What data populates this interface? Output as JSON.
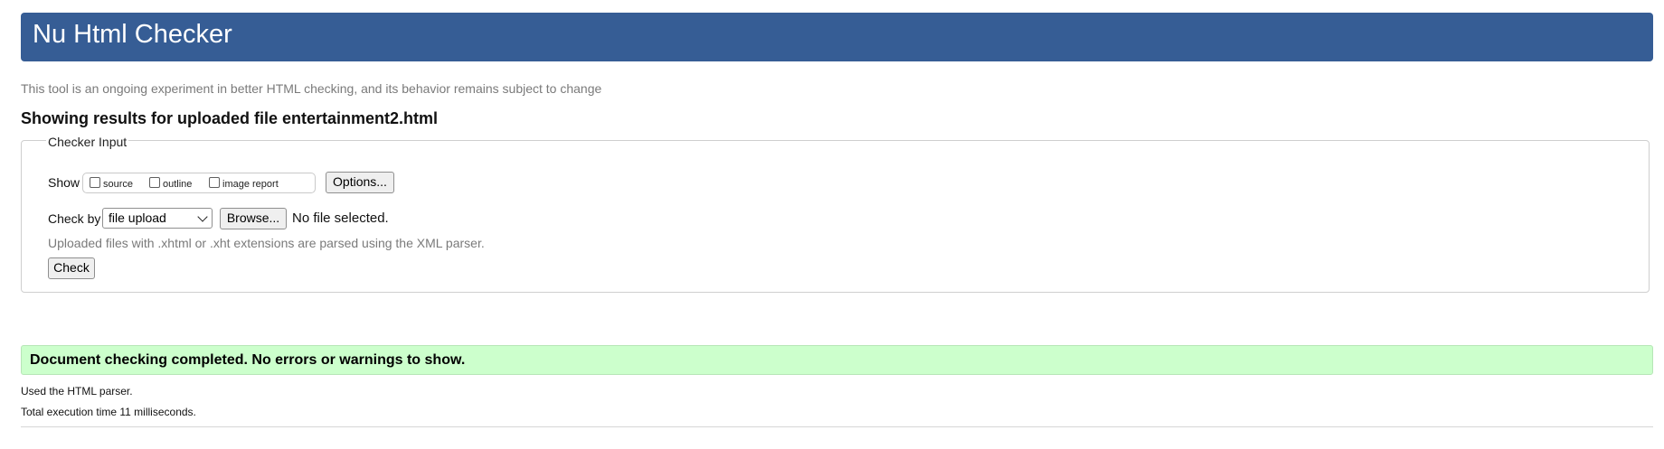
{
  "header": {
    "title": "Nu Html Checker"
  },
  "tagline": "This tool is an ongoing experiment in better HTML checking, and its behavior remains subject to change",
  "results_heading": "Showing results for uploaded file entertainment2.html",
  "checker_input": {
    "legend": "Checker Input",
    "show_label": "Show",
    "options": [
      {
        "label": "source",
        "checked": false
      },
      {
        "label": "outline",
        "checked": false
      },
      {
        "label": "image report",
        "checked": false
      }
    ],
    "options_button": "Options...",
    "check_by_label": "Check by",
    "check_by_value": "file upload",
    "browse_button": "Browse...",
    "no_file_text": "No file selected.",
    "hint": "Uploaded files with .xhtml or .xht extensions are parsed using the XML parser.",
    "check_button": "Check"
  },
  "result": {
    "message": "Document checking completed. No errors or warnings to show.",
    "details": [
      "Used the HTML parser.",
      "Total execution time 11 milliseconds."
    ]
  },
  "colors": {
    "header_bg": "#365d95",
    "success_bg": "#ccffcc",
    "muted_text": "#7a7a7a"
  }
}
